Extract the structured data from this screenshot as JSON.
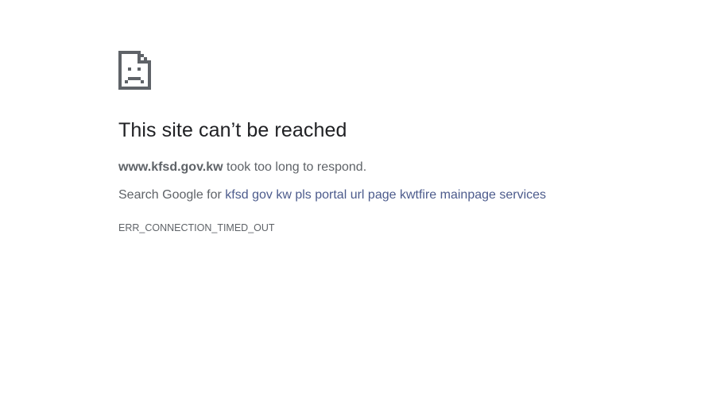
{
  "error_page": {
    "icon": "sad-page-icon",
    "title": "This site can’t be reached",
    "host": "www.kfsd.gov.kw",
    "message_suffix": " took too long to respond.",
    "search_prefix": "Search Google for ",
    "search_query": "kfsd gov kw pls portal url page kwtfire mainpage services",
    "error_code": "ERR_CONNECTION_TIMED_OUT",
    "colors": {
      "title": "#202124",
      "body_text": "#5f6368",
      "link": "#4c5b8c",
      "icon": "#5f6368"
    }
  }
}
